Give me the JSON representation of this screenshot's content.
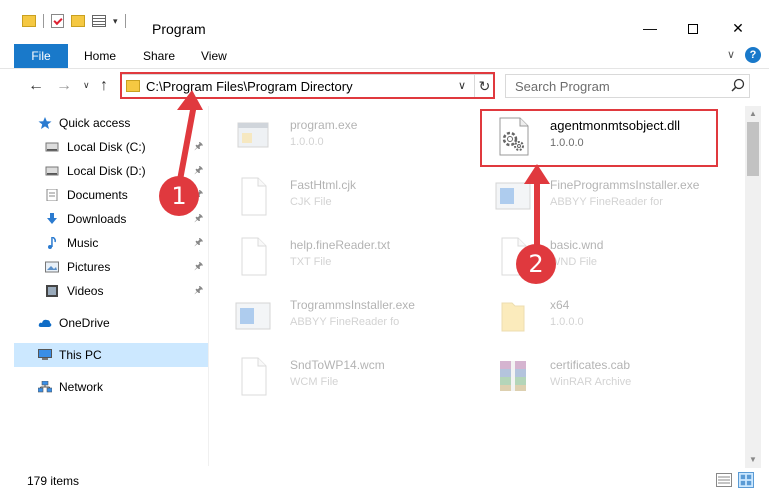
{
  "window": {
    "title": "Program",
    "minimize": "—",
    "close": "✕"
  },
  "ribbon": {
    "tabs": [
      "File",
      "Home",
      "Share",
      "View"
    ],
    "help": "?"
  },
  "nav": {
    "back": "←",
    "forward": "→",
    "recent": "∨",
    "up": "↑",
    "address": "C:\\Program Files\\Program Directory",
    "address_dropdown": "∨",
    "refresh": "↻",
    "search_placeholder": "Search Program"
  },
  "sidebar": {
    "items": [
      {
        "label": "Quick access",
        "icon": "star-icon",
        "pinned": false
      },
      {
        "label": "Local Disk (C:)",
        "icon": "drive-icon",
        "pinned": true
      },
      {
        "label": "Local Disk (D:)",
        "icon": "drive-icon",
        "pinned": true
      },
      {
        "label": "Documents",
        "icon": "documents-icon",
        "pinned": true
      },
      {
        "label": "Downloads",
        "icon": "download-icon",
        "pinned": true
      },
      {
        "label": "Music",
        "icon": "music-icon",
        "pinned": true
      },
      {
        "label": "Pictures",
        "icon": "pictures-icon",
        "pinned": true
      },
      {
        "label": "Videos",
        "icon": "videos-icon",
        "pinned": true
      },
      {
        "label": "OneDrive",
        "icon": "cloud-icon",
        "pinned": false
      },
      {
        "label": "This PC",
        "icon": "computer-icon",
        "pinned": false,
        "selected": true
      },
      {
        "label": "Network",
        "icon": "network-icon",
        "pinned": false
      }
    ],
    "pin_glyph": "📌"
  },
  "files": [
    {
      "name": "program.exe",
      "sub": "1.0.0.0",
      "icon": "exe-icon",
      "highlighted": false
    },
    {
      "name": "agentmonmtsobject.dll",
      "sub": "1.0.0.0",
      "icon": "dll-gear-icon",
      "highlighted": true
    },
    {
      "name": "FastHtml.cjk",
      "sub": "CJK File",
      "icon": "blank-file-icon",
      "highlighted": false
    },
    {
      "name": "FineProgrammsInstaller.exe",
      "sub": "ABBYY FineReader for",
      "icon": "installer-icon",
      "highlighted": false
    },
    {
      "name": "help.fineReader.txt",
      "sub": "TXT File",
      "icon": "blank-file-icon",
      "highlighted": false
    },
    {
      "name": "basic.wnd",
      "sub": "WND File",
      "icon": "blank-file-icon",
      "highlighted": false
    },
    {
      "name": "TrogrammsInstaller.exe",
      "sub": "ABBYY FineReader fo",
      "icon": "installer-icon",
      "highlighted": false
    },
    {
      "name": "x64",
      "sub": "1.0.0.0",
      "icon": "folder-icon",
      "highlighted": false
    },
    {
      "name": "SndToWP14.wcm",
      "sub": "WCM File",
      "icon": "blank-file-icon",
      "highlighted": false
    },
    {
      "name": "certificates.cab",
      "sub": "WinRAR Archive",
      "icon": "winrar-icon",
      "highlighted": false
    }
  ],
  "status": {
    "item_count": "179 items"
  },
  "callouts": [
    "1",
    "2"
  ],
  "colors": {
    "accent": "#1979ca",
    "highlight": "#e0393e",
    "selected_bg": "#cce8ff"
  }
}
